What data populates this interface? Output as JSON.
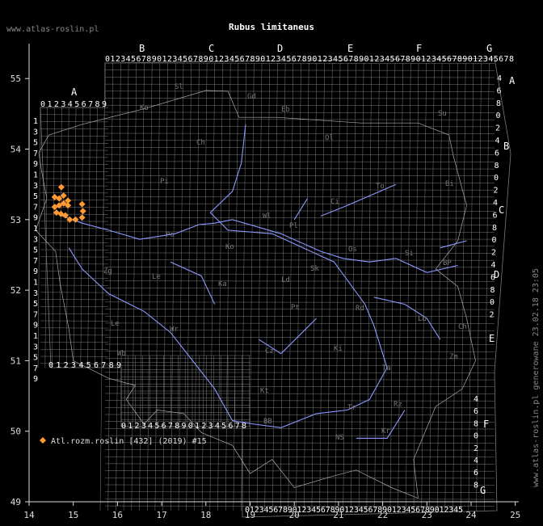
{
  "title": "Rubus limitaneus",
  "site_url": "www.atlas-roslin.pl",
  "credit": "www.atlas-roslin.pl generowane 23.02.18 23:05",
  "legend": {
    "label": "Atl.rozm.roslin [432] (2019) #15",
    "marker_color": "#ff9933"
  },
  "colors": {
    "background": "#000000",
    "grid": "#7a7a7a",
    "river": "#8a9aff",
    "border": "#aaaaaa",
    "marker": "#ff9933"
  },
  "axes": {
    "x_ticks": [
      "14",
      "15",
      "16",
      "17",
      "18",
      "19",
      "20",
      "21",
      "22",
      "23",
      "24",
      "25"
    ],
    "y_ticks": [
      "49",
      "50",
      "51",
      "52",
      "53",
      "54",
      "55"
    ]
  },
  "grid_labels": {
    "top_letters": [
      "B",
      "C",
      "D",
      "E",
      "F",
      "G"
    ],
    "top_digits": "0123456789012345678901234567890123456789012345678901234567890123456789012345678",
    "a_letter": "A",
    "a_digits": "0123456789",
    "left_digits": [
      "1",
      "3",
      "5",
      "7",
      "9",
      "1",
      "3",
      "5",
      "7",
      "9",
      "1",
      "3",
      "5",
      "7",
      "9",
      "1",
      "3",
      "5",
      "7",
      "9",
      "1",
      "3",
      "5",
      "7",
      "9"
    ],
    "right_top_digits": [
      "4",
      "6",
      "8",
      "0",
      "2",
      "4",
      "6",
      "8",
      "0",
      "2",
      "4",
      "6",
      "8",
      "0",
      "2",
      "4",
      "6",
      "8",
      "0",
      "2"
    ],
    "right_letters": [
      "A",
      "B",
      "C",
      "D",
      "E"
    ],
    "bottom_left_digits": "0123456789",
    "bottom_mid_digits": "0123456789012345678",
    "bottom_digits": "0123456789012345678901234567890123456789012345",
    "lower_right_digits": [
      "4",
      "6",
      "8",
      "0",
      "2",
      "4",
      "6",
      "8"
    ],
    "lower_right_letters": [
      "F",
      "G"
    ]
  },
  "regions": [
    "Sl",
    "Ko",
    "Gd",
    "Eb",
    "Su",
    "Ch",
    "Ol",
    "Pi",
    "Bi",
    "To",
    "Ci",
    "Wl",
    "Pl",
    "Po",
    "Ko",
    "Os",
    "Si",
    "BP",
    "Zg",
    "Le",
    "Ka",
    "Sk",
    "Ld",
    "Pt",
    "Rd",
    "Lb",
    "Ch",
    "Le",
    "Wr",
    "Wb",
    "Cz",
    "Ki",
    "Zm",
    "Kt",
    "Ta",
    "Tr",
    "Rz",
    "BB",
    "NS",
    "Kr"
  ],
  "records": [
    {
      "lon": 14.73,
      "lat": 53.46
    },
    {
      "lon": 14.58,
      "lat": 53.32
    },
    {
      "lon": 14.68,
      "lat": 53.3
    },
    {
      "lon": 14.78,
      "lat": 53.34
    },
    {
      "lon": 14.88,
      "lat": 53.27
    },
    {
      "lon": 14.58,
      "lat": 53.18
    },
    {
      "lon": 14.68,
      "lat": 53.2
    },
    {
      "lon": 14.78,
      "lat": 53.23
    },
    {
      "lon": 14.88,
      "lat": 53.2
    },
    {
      "lon": 15.2,
      "lat": 53.22
    },
    {
      "lon": 14.62,
      "lat": 53.1
    },
    {
      "lon": 14.72,
      "lat": 53.08
    },
    {
      "lon": 14.82,
      "lat": 53.06
    },
    {
      "lon": 14.92,
      "lat": 53.0
    },
    {
      "lon": 15.05,
      "lat": 53.0
    },
    {
      "lon": 15.2,
      "lat": 53.03
    },
    {
      "lon": 15.22,
      "lat": 53.12
    }
  ]
}
